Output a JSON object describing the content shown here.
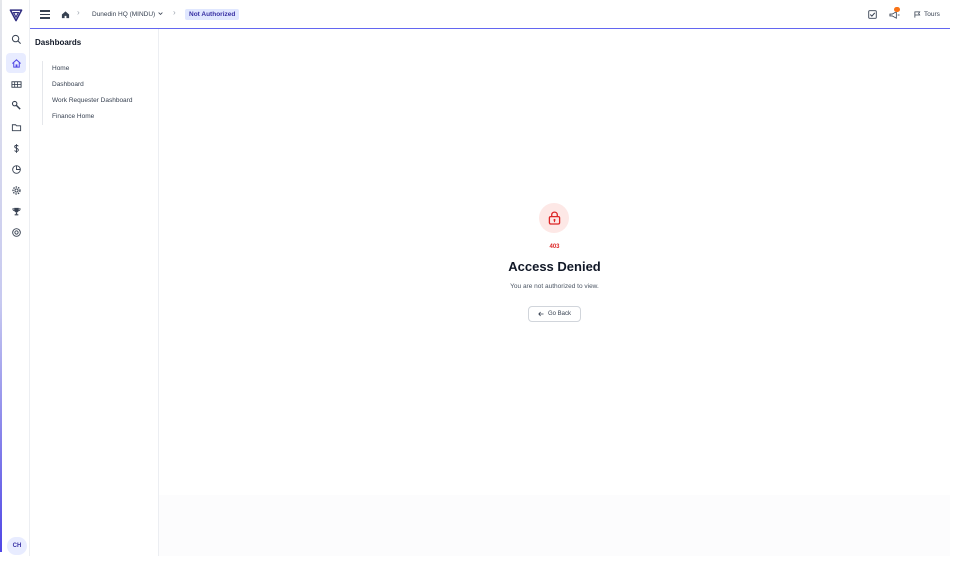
{
  "app": {
    "brand_color": "#4f46e5",
    "logo_icon": "triangle-logo-icon"
  },
  "rail": {
    "items": [
      {
        "name": "search-icon",
        "active": false
      },
      {
        "name": "home-icon",
        "active": true
      },
      {
        "name": "grid-icon",
        "active": false
      },
      {
        "name": "wrench-icon",
        "active": false
      },
      {
        "name": "folder-icon",
        "active": false
      },
      {
        "name": "dollar-icon",
        "active": false
      },
      {
        "name": "pie-chart-icon",
        "active": false
      },
      {
        "name": "gear-icon",
        "active": false
      },
      {
        "name": "trophy-icon",
        "active": false
      },
      {
        "name": "help-circle-icon",
        "active": false
      }
    ],
    "avatar_initials": "CH"
  },
  "topbar": {
    "location": "Dunedin HQ (MINDU)",
    "current_page": "Not Authorized",
    "tours_label": "Tours"
  },
  "sidebar": {
    "title": "Dashboards",
    "items": [
      {
        "label": "Home"
      },
      {
        "label": "Dashboard"
      },
      {
        "label": "Work Requester Dashboard"
      },
      {
        "label": "Finance Home"
      }
    ]
  },
  "error": {
    "code": "403",
    "title": "Access Denied",
    "message": "You are not authorized to view.",
    "go_back_label": "Go Back",
    "accent_color": "#dc2626"
  }
}
